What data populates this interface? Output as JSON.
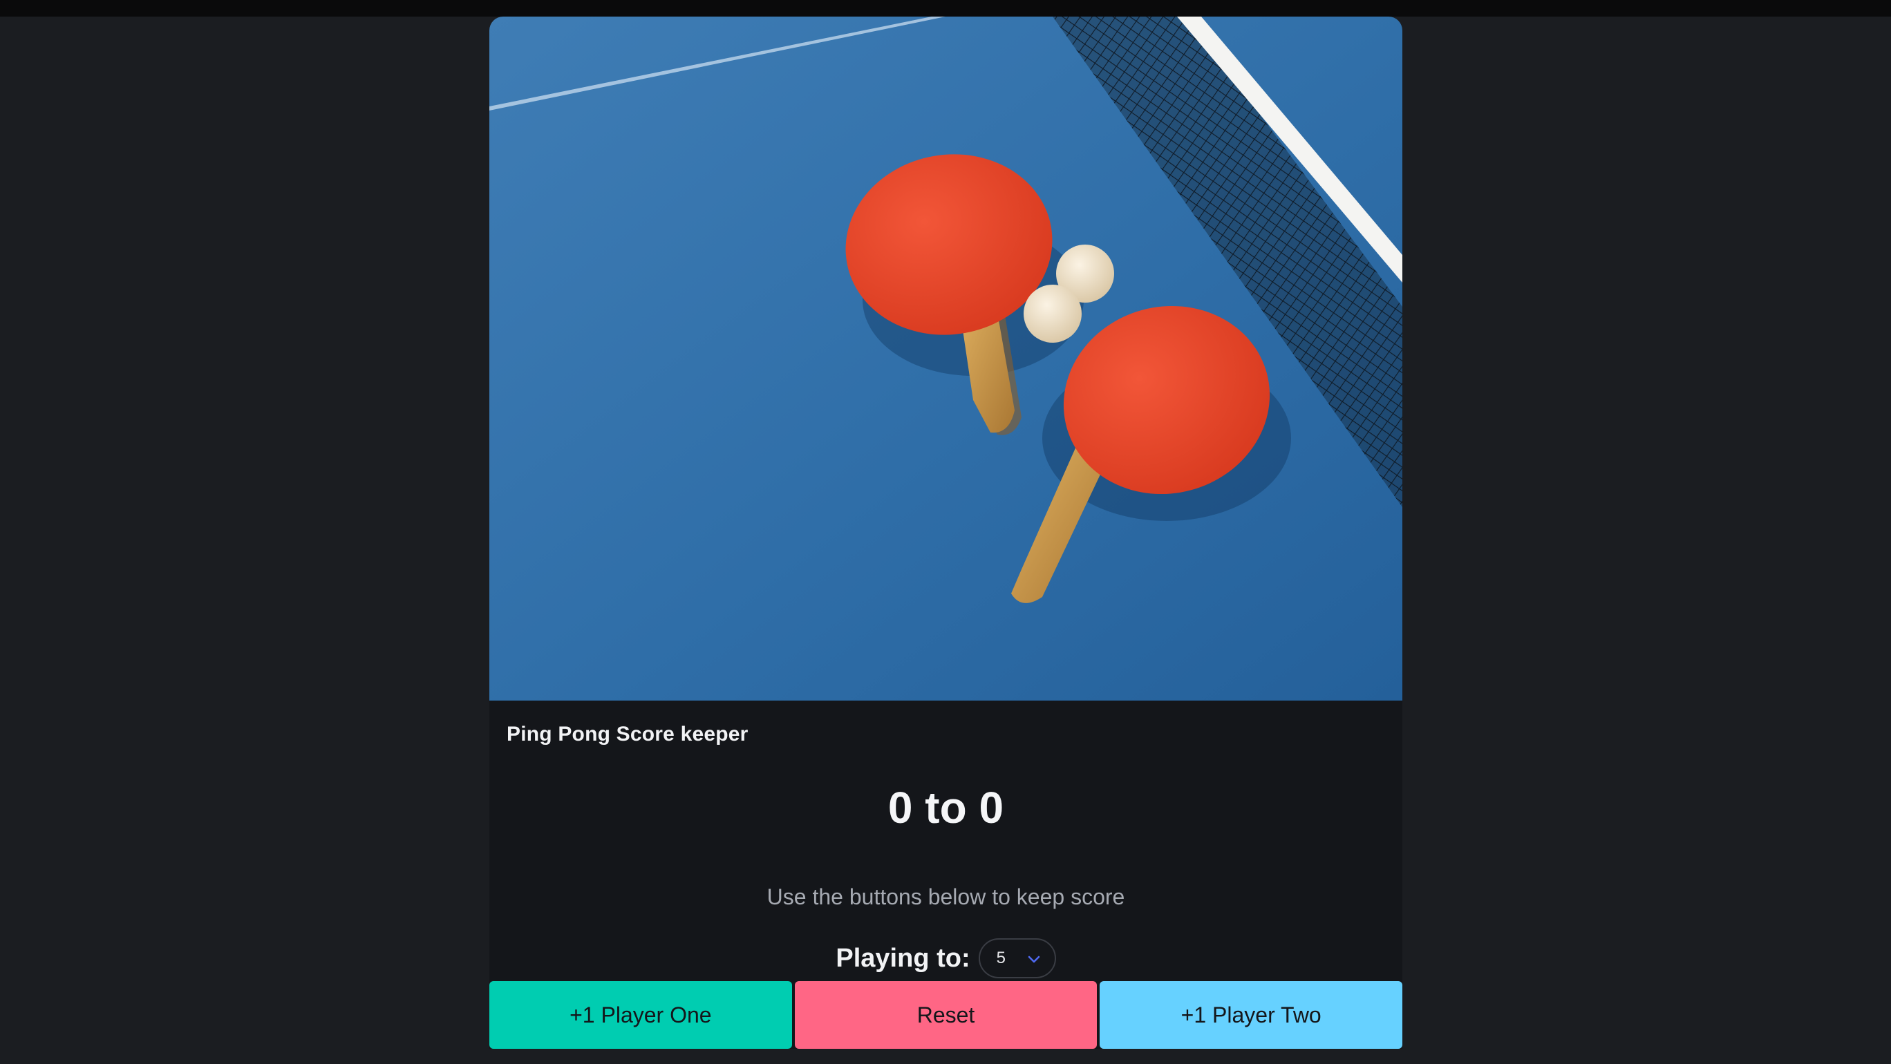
{
  "card": {
    "title": "Ping Pong Score keeper"
  },
  "score": {
    "display": "0 to 0"
  },
  "hint": "Use the buttons below to keep score",
  "playing_to": {
    "label": "Playing to:",
    "selected": "5"
  },
  "buttons": {
    "player_one": "+1 Player One",
    "reset": "Reset",
    "player_two": "+1 Player Two"
  },
  "colors": {
    "player_one": "#00cdb1",
    "reset": "#ff6685",
    "player_two": "#66d1ff",
    "page_bg": "#1b1d21",
    "card_bg": "#14161a"
  },
  "icons": {
    "select_chevron": "chevron-down-icon"
  }
}
